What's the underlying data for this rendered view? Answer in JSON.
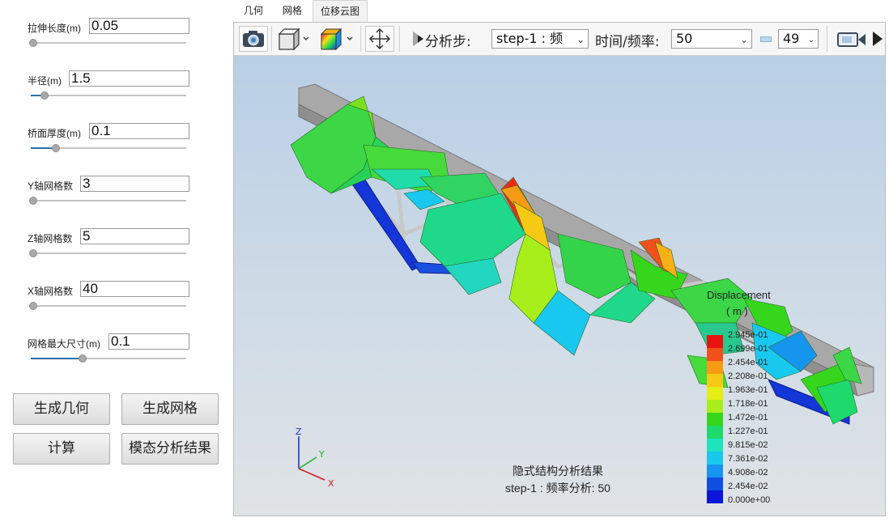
{
  "params": [
    {
      "label": "拉伸长度(m)",
      "value": "0.05",
      "slider_fraction": 0.0
    },
    {
      "label": "半径(m)",
      "value": "1.5",
      "slider_fraction": 0.08
    },
    {
      "label": "桥面厚度(m)",
      "value": "0.1",
      "slider_fraction": 0.15
    },
    {
      "label": "Y轴网格数",
      "value": "3",
      "slider_fraction": 0.0
    },
    {
      "label": "Z轴网格数",
      "value": "5",
      "slider_fraction": 0.0
    },
    {
      "label": "X轴网格数",
      "value": "40",
      "slider_fraction": 0.0
    },
    {
      "label": "网格最大尺寸(m)",
      "value": "0.1",
      "slider_fraction": 0.33
    }
  ],
  "buttons": {
    "generate_geometry": "生成几何",
    "generate_mesh": "生成网格",
    "compute": "计算",
    "modal_results": "模态分析结果"
  },
  "tabs": [
    "几何",
    "网格",
    "位移云图"
  ],
  "active_tab": "位移云图",
  "toolbar": {
    "step_label": "分析步:",
    "step_value": "step-1 : 频",
    "time_label": "时间/频率:",
    "time_value": "50",
    "frame_value": "49",
    "icons": [
      "camera-icon",
      "cube-view-icon",
      "colormap-icon",
      "pan-move-icon",
      "play-icon",
      "video-record-icon"
    ]
  },
  "legend": {
    "title": "Displacement",
    "unit": "( m )",
    "ticks": [
      "2.945e-01",
      "2.699e-01",
      "2.454e-01",
      "2.208e-01",
      "1.963e-01",
      "1.718e-01",
      "1.472e-01",
      "1.227e-01",
      "9.815e-02",
      "7.361e-02",
      "4.908e-02",
      "2.454e-02",
      "0.000e+00"
    ],
    "colors": [
      "#e8140f",
      "#f2501a",
      "#f89a16",
      "#f6c914",
      "#e3ee14",
      "#a8ee1a",
      "#36d61d",
      "#1ed96b",
      "#1fe3bd",
      "#18c8ef",
      "#1695ee",
      "#0f4fe0",
      "#0c16d6"
    ]
  },
  "caption": {
    "line1": "隐式结构分析结果",
    "line2": "step-1 : 频率分析: 50"
  },
  "axes": {
    "x": "X",
    "y": "Y",
    "z": "Z"
  }
}
